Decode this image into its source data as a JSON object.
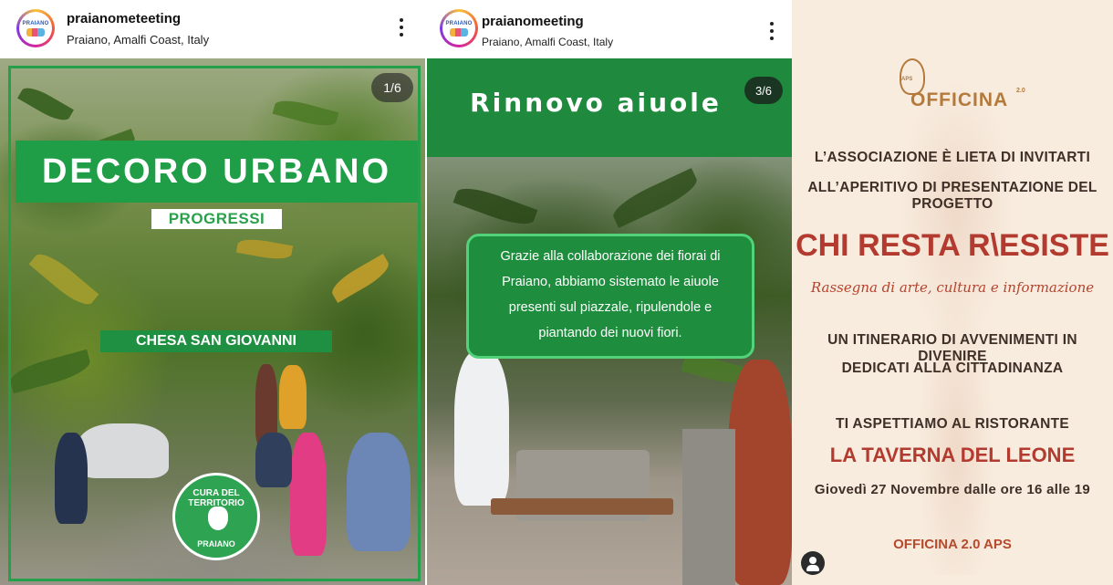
{
  "post1": {
    "username": "praianometeeting",
    "location": "Praiano, Amalfi Coast, Italy",
    "avatar_text": "PRAIANO",
    "counter": "1/6",
    "banner_title": "DECORO URBANO",
    "subtitle": "PROGRESSI",
    "place": "CHESA SAN GIOVANNI",
    "seal_top": "CURA DEL TERRITORIO",
    "seal_bottom": "PRAIANO",
    "accent_color": "#1f9e47"
  },
  "post2": {
    "username": "praianomeeting",
    "location": "Praiano, Amalfi Coast, Italy",
    "avatar_text": "PRAIANO",
    "counter": "3/6",
    "title": "Rinnovo aiuole",
    "caption": "Grazie alla collaborazione dei fiorai di Praiano, abbiamo sistemato le aiuole presenti sul piazzale, ripulendole e piantando dei nuovi fiori.",
    "accent_color": "#1f8a3d"
  },
  "post3": {
    "logo": {
      "aps": "APS",
      "name": "OFFICINA",
      "suffix": "2.0"
    },
    "invite_line1": "L’ASSOCIAZIONE È LIETA DI INVITARTI",
    "invite_line2": "ALL’APERITIVO DI PRESENTAZIONE DEL PROGETTO",
    "project_title": "CHI RESTA R\\ESISTE",
    "project_subtitle": "Rassegna di arte, cultura e informazione",
    "itinerary_line1": "UN ITINERARIO DI AVVENIMENTI IN DIVENIRE",
    "itinerary_line2": "DEDICATI ALLA CITTADINANZA",
    "wait_line": "TI ASPETTIAMO AL RISTORANTE",
    "venue": "LA TAVERNA DEL LEONE",
    "date_line": "Giovedì 27 Novembre dalle ore 16 alle 19",
    "footer": "OFFICINA 2.0 APS",
    "accent_color": "#b33a2f"
  }
}
